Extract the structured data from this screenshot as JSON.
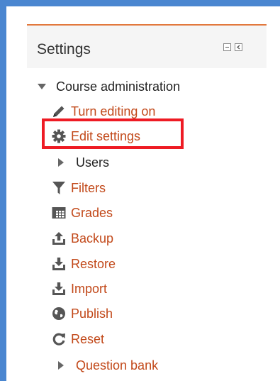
{
  "settings_block": {
    "title": "Settings",
    "collapse_icon": "minus-box-icon",
    "dock_icon": "dock-left-icon"
  },
  "course_admin": {
    "label": "Course administration",
    "expand_icon": "triangle-down-icon",
    "items": [
      {
        "label": "Turn editing on",
        "icon": "pencil-icon"
      },
      {
        "label": "Edit settings",
        "icon": "gear-icon"
      },
      {
        "label": "Users",
        "icon": "triangle-right-icon"
      },
      {
        "label": "Filters",
        "icon": "filter-icon"
      },
      {
        "label": "Grades",
        "icon": "table-icon"
      },
      {
        "label": "Backup",
        "icon": "upload-icon"
      },
      {
        "label": "Restore",
        "icon": "download-icon"
      },
      {
        "label": "Import",
        "icon": "download-icon"
      },
      {
        "label": "Publish",
        "icon": "globe-icon"
      },
      {
        "label": "Reset",
        "icon": "refresh-icon"
      },
      {
        "label": "Question bank",
        "icon": "triangle-right-icon"
      }
    ]
  },
  "colors": {
    "frame": "#4a86d0",
    "accent": "#e2783c",
    "link": "#c2491a",
    "highlight": "#ee1b24"
  }
}
